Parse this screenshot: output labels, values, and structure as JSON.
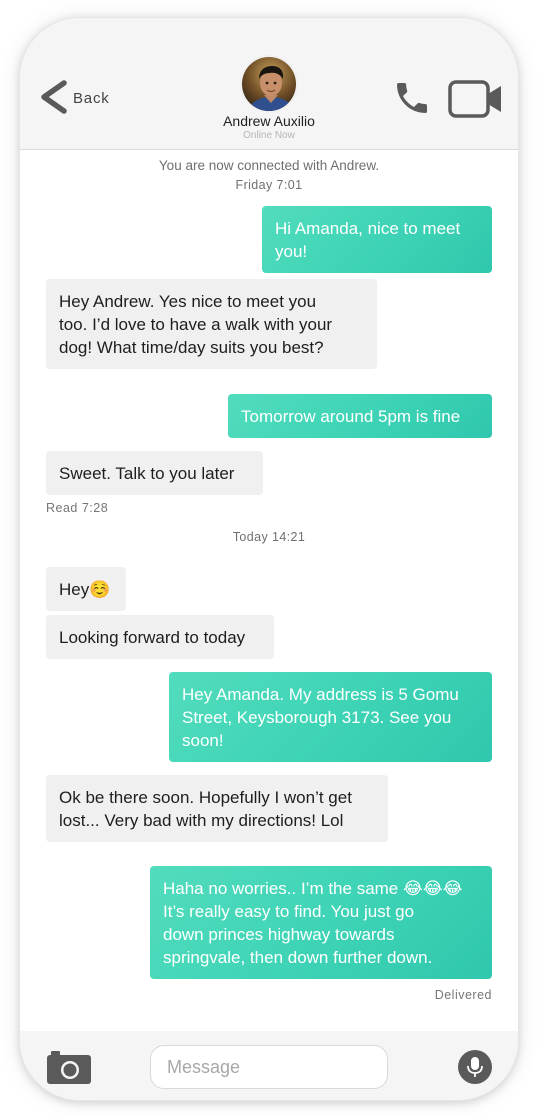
{
  "header": {
    "back_label": "Back",
    "contact_name": "Andrew Auxilio",
    "contact_status": "Online Now"
  },
  "chat": {
    "system_message": "You are now connected with Andrew.",
    "timestamp_1": "Friday 7:01",
    "timestamp_2": "Today 14:21",
    "read_receipt": "Read 7:28",
    "delivered_status": "Delivered",
    "messages": [
      {
        "direction": "outgoing",
        "text": "Hi Amanda, nice to meet\nyou!"
      },
      {
        "direction": "incoming",
        "text": "Hey Andrew. Yes nice to meet you\ntoo. I’d love to have a walk with your\ndog! What time/day suits you best?"
      },
      {
        "direction": "outgoing",
        "text": "Tomorrow around 5pm is fine"
      },
      {
        "direction": "incoming",
        "text": "Sweet. Talk to you later"
      },
      {
        "direction": "incoming",
        "text": "Hey☺️"
      },
      {
        "direction": "incoming",
        "text": "Looking forward to today"
      },
      {
        "direction": "outgoing",
        "text": "Hey Amanda. My address is 5 Gomu\nStreet, Keysborough 3173. See you\nsoon!"
      },
      {
        "direction": "incoming",
        "text": "Ok be there soon. Hopefully I won’t get\nlost... Very bad with my directions! Lol"
      },
      {
        "direction": "outgoing",
        "text": "Haha no worries.. I’m the same 😂😂😂\nIt’s really easy to find. You just go\ndown princes highway towards\nspringvale, then down further down."
      }
    ]
  },
  "composer": {
    "placeholder": "Message",
    "value": ""
  },
  "icons": {
    "back": "chevron-left-icon",
    "call": "phone-icon",
    "video": "video-camera-icon",
    "camera": "camera-icon",
    "mic": "microphone-icon"
  },
  "colors": {
    "outgoing_bubble": "#3fd4b6",
    "incoming_bubble": "#f0f0f0",
    "header_bg": "#f5f5f5",
    "icon_gray": "#5a5a5a"
  }
}
